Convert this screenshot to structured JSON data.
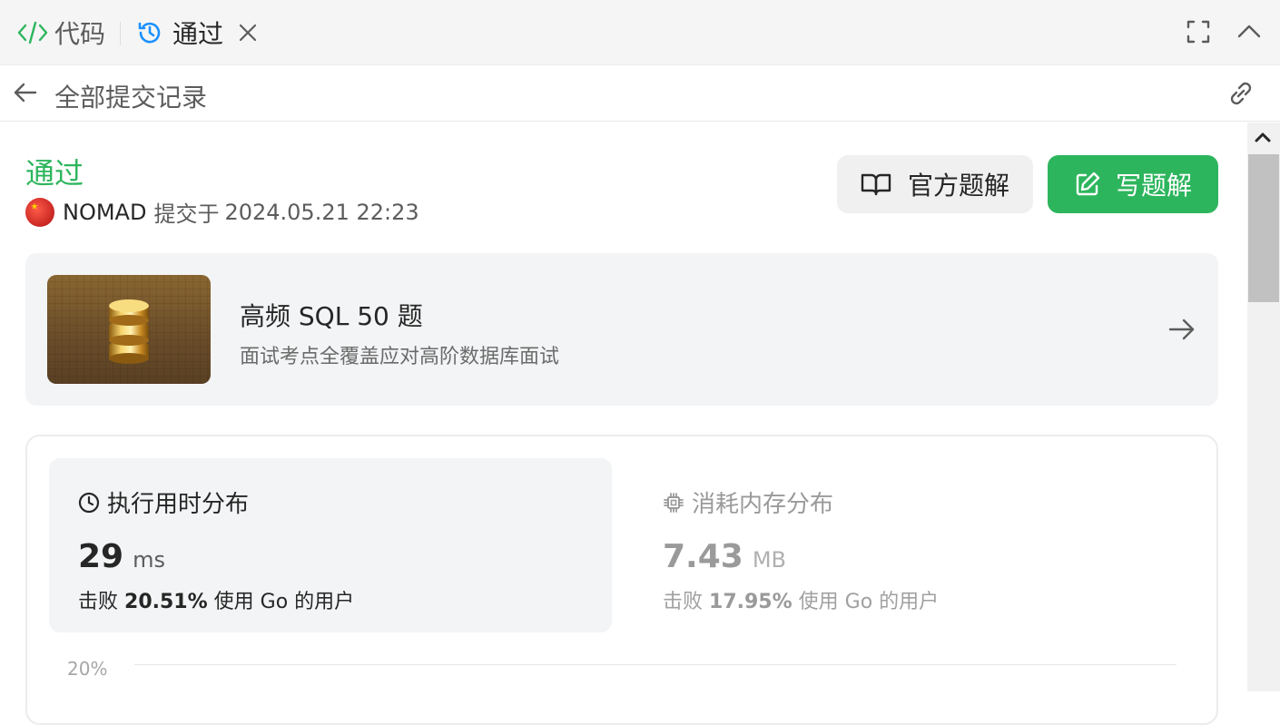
{
  "tabs": {
    "code": {
      "label": "代码",
      "icon": "code-icon",
      "color": "#2db55d"
    },
    "result": {
      "label": "通过",
      "icon": "history-icon",
      "color": "#1a90ff"
    }
  },
  "breadcrumb": {
    "title": "全部提交记录"
  },
  "submission": {
    "status": "通过",
    "status_color": "#2db55d",
    "user": "NOMAD",
    "submitted_label": "提交于",
    "timestamp": "2024.05.21 22:23"
  },
  "actions": {
    "official_solution": "官方题解",
    "write_solution": "写题解",
    "accent": "#2db55d"
  },
  "study_plan": {
    "title": "高频 SQL 50 题",
    "subtitle": "面试考点全覆盖应对高阶数据库面试"
  },
  "runtime": {
    "heading": "执行用时分布",
    "value": "29",
    "unit": "ms",
    "beats_prefix": "击败",
    "beats_pct": "20.51%",
    "beats_suffix": "使用 Go 的用户"
  },
  "memory": {
    "heading": "消耗内存分布",
    "value": "7.43",
    "unit": "MB",
    "beats_prefix": "击败",
    "beats_pct": "17.95%",
    "beats_suffix": "使用 Go 的用户"
  },
  "chart": {
    "y_tick": "20%"
  }
}
